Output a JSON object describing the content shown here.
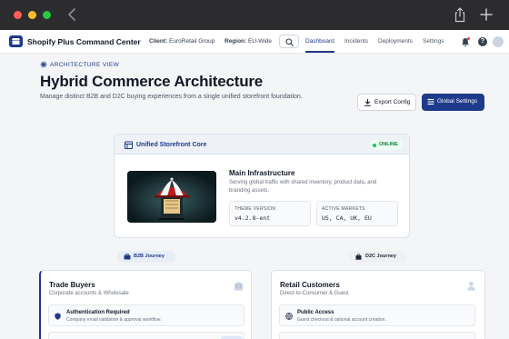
{
  "app": {
    "brand": "Shopify Plus Command Center",
    "client_label": "Client:",
    "client_value": "EuroRetail Group",
    "region_label": "Region:",
    "region_value": "EU-Wide"
  },
  "nav": {
    "links": [
      "Dashboard",
      "Incidents",
      "Deployments",
      "Settings"
    ],
    "active": "Dashboard"
  },
  "header": {
    "eyebrow": "ARCHITECTURE VIEW",
    "title": "Hybrid Commerce Architecture",
    "subtitle": "Manage distinct B2B and D2C buying experiences from a single unified storefront foundation.",
    "export_label": "Export Config",
    "global_label": "Global Settings"
  },
  "core": {
    "title": "Unified Storefront Core",
    "status": "ONLINE",
    "infra_title": "Main Infrastructure",
    "infra_desc": "Serving global traffic with shared inventory, product data, and branding assets.",
    "theme_key": "THEME VERSION",
    "theme_value": "v4.2.8-ent",
    "markets_key": "ACTIVE MARKETS",
    "markets_value": "US, CA, UK, EU"
  },
  "journeys": {
    "b2b_pill": "B2B Journey",
    "d2c_pill": "D2C Journey",
    "b2b": {
      "title": "Trade Buyers",
      "subtitle": "Corporate accounts & Wholesale",
      "feature_title": "Authentication Required",
      "feature_desc": "Company email validation & approval workflow."
    },
    "d2c": {
      "title": "Retail Customers",
      "subtitle": "Direct-to-Consumer & Guest",
      "feature_title": "Public Access",
      "feature_desc": "Guest checkout & optional account creation."
    }
  },
  "colors": {
    "brand_navy": "#1e3a8a",
    "online_green": "#22c55e",
    "notification_red": "#ef4444"
  }
}
